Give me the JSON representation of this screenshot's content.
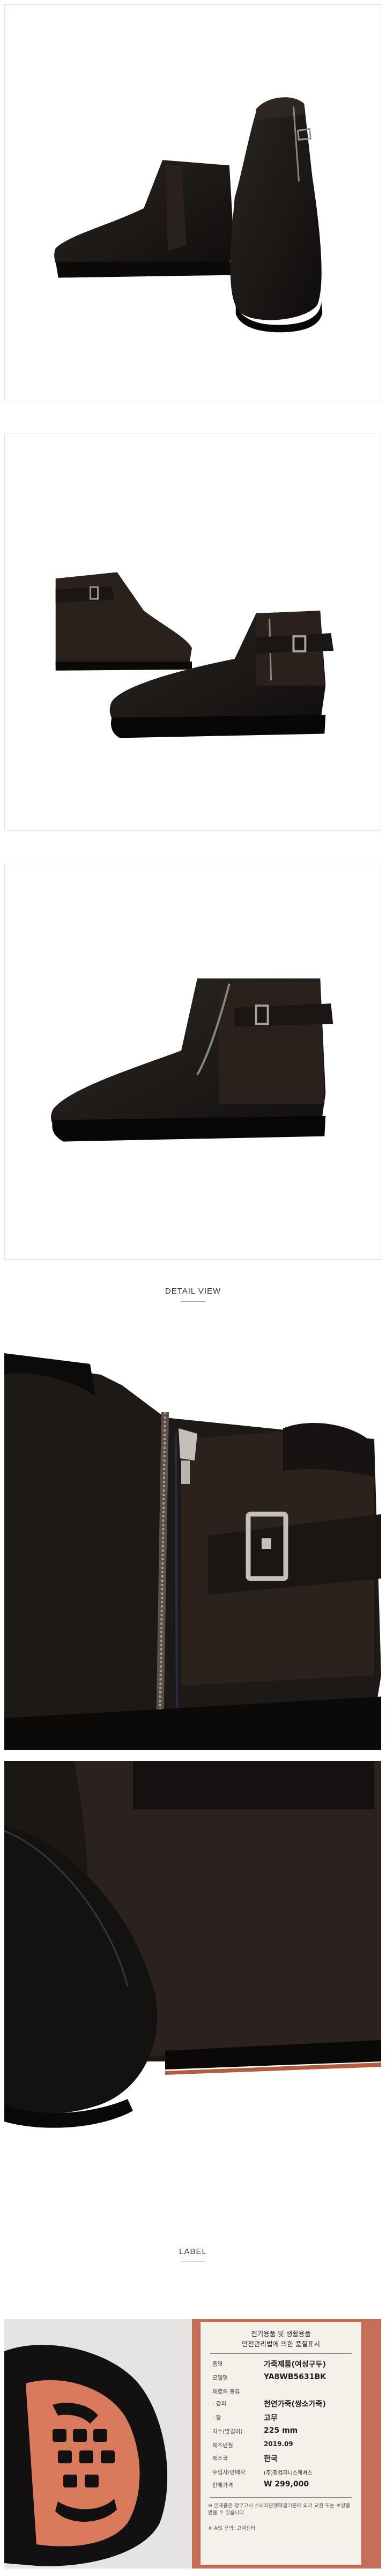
{
  "headings": {
    "detail_view": "DETAIL VIEW",
    "label": "LABEL"
  },
  "photos": [
    {
      "name": "boots-pair-front",
      "color_leather": "#1b1816",
      "color_suede": "#2a211d"
    },
    {
      "name": "boots-pair-side",
      "color_leather": "#1b1816",
      "color_suede": "#2a211d"
    },
    {
      "name": "boot-single-side",
      "color_leather": "#1b1816",
      "color_suede": "#2a211d"
    }
  ],
  "label_tag": {
    "title_line1": "전기용품 및 생활용품",
    "title_line2": "안전관리법에 의한 품질표시",
    "rows": [
      {
        "key": "품명",
        "value": "가죽제품(여성구두)"
      },
      {
        "key": "모델명",
        "value": "YA8WB5631BK"
      },
      {
        "key": "재료의 종류",
        "value": ""
      },
      {
        "key": "· 갑피",
        "value": "천연가죽(쌍소가죽)"
      },
      {
        "key": "· 창",
        "value": "고무"
      },
      {
        "key": "치수(발길이)",
        "value": "225 mm"
      },
      {
        "key": "제조년월",
        "value": "2019.09"
      },
      {
        "key": "제조국",
        "value": "한국"
      },
      {
        "key": "수입자/판매자",
        "value": "(주)핑컴퍼니스케쳐스"
      },
      {
        "key": "판매가격",
        "value": "W 299,000"
      }
    ],
    "notes": [
      "※ 본제품은 정부고시 소비자분쟁해결기준에 의거 교환 또는 보상을 받을 수 있습니다.",
      "※ A/S 문의: 고객센터"
    ]
  },
  "colors": {
    "frame_border": "#e3e3e3",
    "tag_background": "#c66e57",
    "sole_orange": "#d97a5c",
    "heading_text": "#333333"
  }
}
